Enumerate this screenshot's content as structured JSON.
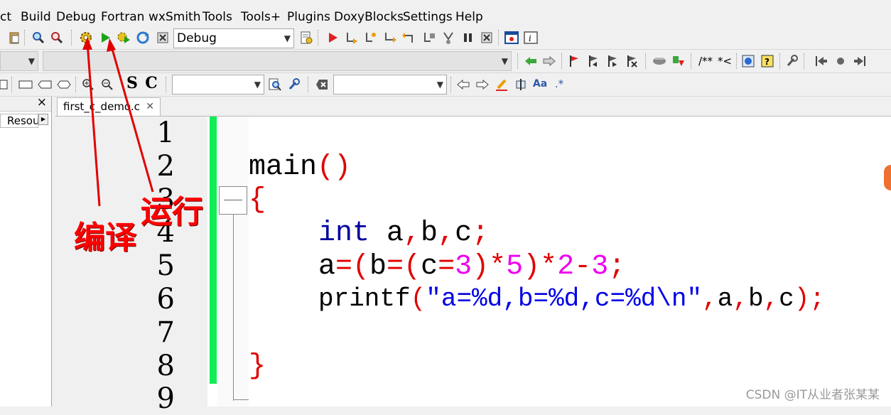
{
  "menu": [
    "ct",
    "Build",
    "Debug",
    "Fortran",
    "wxSmith",
    "Tools",
    "Tools+",
    "Plugins",
    "DoxyBlocks",
    "Settings",
    "Help"
  ],
  "build_target": "Debug",
  "left_panel": {
    "close": "×",
    "tab": "Resou"
  },
  "tab": {
    "label": "first_c_demo.c",
    "close": "✕"
  },
  "line_numbers": [
    "1",
    "2",
    "3",
    "4",
    "5",
    "6",
    "7",
    "8",
    "9"
  ],
  "code": {
    "l2_a": "main",
    "l2_b": "()",
    "l3": "{",
    "l4_kw": "int",
    "l4_vars": " a",
    "l4_c1": ",",
    "l4_b": "b",
    "l4_c2": ",",
    "l4_c": "c",
    "l4_end": ";",
    "l5": [
      {
        "t": "a",
        "c": "fn"
      },
      {
        "t": "=(",
        "c": "op"
      },
      {
        "t": "b",
        "c": "fn"
      },
      {
        "t": "=(",
        "c": "op"
      },
      {
        "t": "c",
        "c": "fn"
      },
      {
        "t": "=",
        "c": "op"
      },
      {
        "t": "3",
        "c": "num"
      },
      {
        "t": ")*",
        "c": "op"
      },
      {
        "t": "5",
        "c": "num"
      },
      {
        "t": ")*",
        "c": "op"
      },
      {
        "t": "2",
        "c": "num"
      },
      {
        "t": "-",
        "c": "op"
      },
      {
        "t": "3",
        "c": "num"
      },
      {
        "t": ";",
        "c": "op"
      }
    ],
    "l6": [
      {
        "t": "printf",
        "c": "fn"
      },
      {
        "t": "(",
        "c": "op"
      },
      {
        "t": "\"a=%d,b=%d,c=%d\\n\"",
        "c": "str"
      },
      {
        "t": ",",
        "c": "op"
      },
      {
        "t": "a",
        "c": "fn"
      },
      {
        "t": ",",
        "c": "op"
      },
      {
        "t": "b",
        "c": "fn"
      },
      {
        "t": ",",
        "c": "op"
      },
      {
        "t": "c",
        "c": "fn"
      },
      {
        "t": ");",
        "c": "op"
      }
    ],
    "l8": "}"
  },
  "annotations": {
    "compile": "编译",
    "run": "运行"
  },
  "toolbar_text": {
    "doc_comment": "/**",
    "line_comment": "*<",
    "s": "S",
    "c": "C",
    "aa": "Aa",
    "regex": ".*"
  },
  "watermark": "CSDN @IT从业者张某某",
  "colors": {
    "accent_green": "#11ee55",
    "annotation_red": "#ff0000"
  }
}
